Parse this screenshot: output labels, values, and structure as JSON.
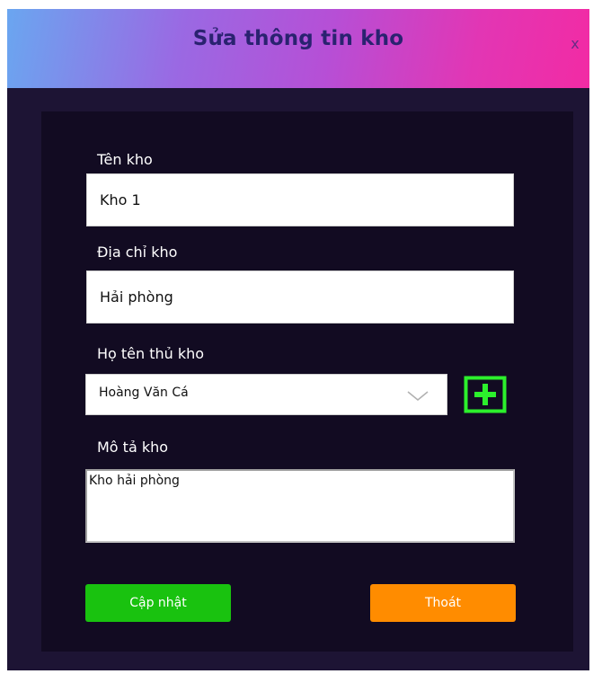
{
  "window": {
    "title": "Sửa thông tin kho",
    "close_label": "x"
  },
  "form": {
    "warehouse_name": {
      "label": "Tên kho",
      "value": "Kho 1"
    },
    "warehouse_address": {
      "label": "Địa chỉ kho",
      "value": "Hải phòng"
    },
    "keeper": {
      "label": "Họ tên thủ kho",
      "selected": "Hoàng Văn Cá",
      "add_icon": "plus-square-icon"
    },
    "description": {
      "label": "Mô tả kho",
      "value": "Kho hải phòng"
    }
  },
  "actions": {
    "update_label": "Cập nhật",
    "exit_label": "Thoát"
  },
  "colors": {
    "window_bg": "#1d1434",
    "panel_bg": "#120b22",
    "update_button": "#19c20f",
    "exit_button": "#ff8c00",
    "add_icon": "#2cf02c"
  }
}
